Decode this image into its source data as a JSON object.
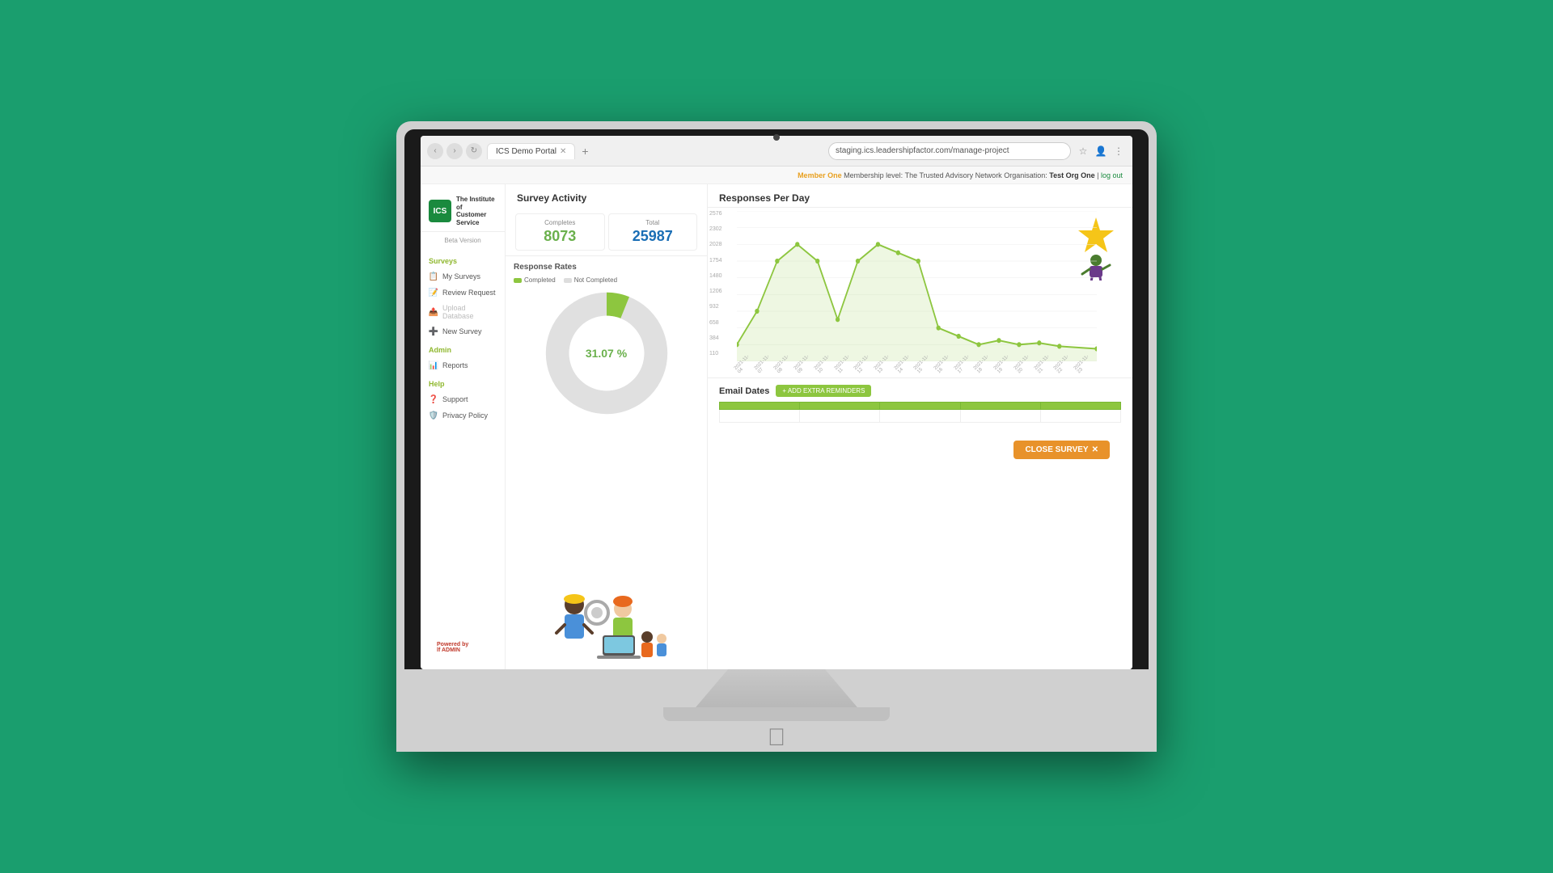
{
  "browser": {
    "tab_label": "ICS Demo Portal",
    "address": "staging.ics.leadershipfactor.com/manage-project",
    "new_tab": "+"
  },
  "topbar": {
    "member_label": "Member One",
    "membership_text": "Membership level:",
    "membership_level": "The Trusted Advisory Network",
    "org_label": "Organisation:",
    "org_name": "Test Org One",
    "separator": "|",
    "logout_label": "log out"
  },
  "sidebar": {
    "logo_initials": "ICS",
    "logo_text": "The Institute of\nCustomer Service",
    "beta_label": "Beta Version",
    "sections": {
      "surveys": {
        "title": "Surveys",
        "items": [
          {
            "label": "My Surveys",
            "icon": "📋"
          },
          {
            "label": "Review Request",
            "icon": "📝"
          },
          {
            "label": "Upload Database",
            "icon": "📤"
          },
          {
            "label": "New Survey",
            "icon": "➕"
          }
        ]
      },
      "admin": {
        "title": "Admin",
        "items": [
          {
            "label": "Reports",
            "icon": "📊"
          }
        ]
      },
      "help": {
        "title": "Help",
        "items": [
          {
            "label": "Support",
            "icon": "❓"
          },
          {
            "label": "Privacy Policy",
            "icon": "🛡️"
          }
        ]
      }
    },
    "powered_by": "Powered by",
    "powered_by_brand": "lf ADMIN"
  },
  "survey_activity": {
    "title": "Survey Activity",
    "completes_label": "Completes",
    "completes_value": "8073",
    "total_label": "Total",
    "total_value": "25987",
    "chart_title": "Response Rates",
    "legend_completed": "Completed",
    "legend_not_completed": "Not Completed",
    "donut_percentage": "31.07 %",
    "donut_completed_pct": 31.07,
    "donut_total": 100
  },
  "responses_per_day": {
    "title": "Responses Per Day",
    "y_labels": [
      "2576",
      "2302",
      "2028",
      "1754",
      "1480",
      "1206",
      "932",
      "658",
      "384",
      "110"
    ],
    "x_labels": [
      "2021-11-04",
      "2021-11-07",
      "2021-11-08",
      "2021-11-09",
      "2021-11-10",
      "2021-11-11",
      "2021-11-12",
      "2021-11-13",
      "2021-11-14",
      "2021-11-15",
      "2021-11-16",
      "2021-11-17",
      "2021-11-18",
      "2021-11-19",
      "2021-11-20",
      "2021-11-21",
      "2021-11-22",
      "2021-11-23"
    ]
  },
  "email_dates": {
    "title": "Email Dates",
    "add_reminders_label": "+ ADD EXTRA REMINDERS",
    "columns": [
      "",
      "",
      "",
      "",
      ""
    ],
    "rows": [
      [
        "",
        "",
        "",
        "",
        ""
      ],
      [
        "",
        "",
        "",
        "",
        ""
      ]
    ]
  },
  "close_survey": {
    "label": "CLOSE SURVEY",
    "icon": "✕"
  }
}
